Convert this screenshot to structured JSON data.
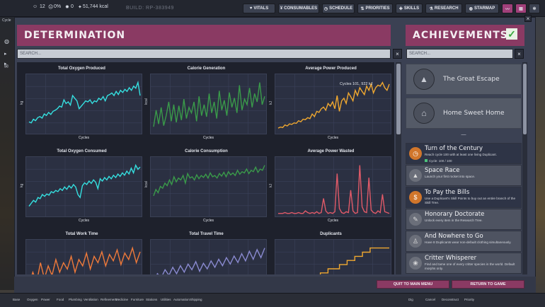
{
  "hud": {
    "dupes": "12",
    "stress": "0%",
    "germs": "0",
    "calories": "51,744 kcal",
    "build": "BUILD: RP-383949",
    "buttons": [
      "VITALS",
      "CONSUMABLES",
      "SCHEDULE",
      "PRIORITIES",
      "SKILLS",
      "RESEARCH",
      "STARMAP"
    ],
    "left_labels": [
      "Cycle"
    ]
  },
  "window": {
    "title": "DETERMINATION",
    "search_placeholder": "SEARCH...",
    "clear_label": "×",
    "close_label": "×"
  },
  "achievements_panel": {
    "title": "ACHIEVEMENTS",
    "search_placeholder": "SEARCH...",
    "clear_label": "×",
    "check_icon": "check-icon",
    "featured": [
      {
        "name": "The Great Escape",
        "icon": "rocket-icon"
      },
      {
        "name": "Home Sweet Home",
        "icon": "house-icon"
      }
    ],
    "separator": "—",
    "items": [
      {
        "title": "Turn of the Century",
        "desc": "Reach cycle 100 with at least one living Duplicant.",
        "progress": "Cycle: 100 / 100",
        "state": "complete",
        "icon": "clock-icon",
        "color": "#d1762b"
      },
      {
        "title": "Space Race",
        "desc": "Launch your first rocket into space.",
        "progress": "",
        "state": "locked",
        "icon": "rocket-icon",
        "color": "#6b6f7a"
      },
      {
        "title": "To Pay the Bills",
        "desc": "Use a Duplicant's Skill Points to buy out an entire branch of the Skill Tree.",
        "progress": "",
        "state": "complete",
        "icon": "coin-icon",
        "color": "#d1762b"
      },
      {
        "title": "Honorary Doctorate",
        "desc": "Unlock every item in the Research Tree.",
        "progress": "",
        "state": "locked",
        "icon": "cap-icon",
        "color": "#6b6f7a"
      },
      {
        "title": "And Nowhere to Go",
        "desc": "Have 8 Duplicants wear non-default clothing simultaneously.",
        "progress": "",
        "state": "locked",
        "icon": "person-icon",
        "color": "#6b6f7a"
      },
      {
        "title": "Critter Whisperer",
        "desc": "Find and tame one of every critter species in the world. Default morphs only.",
        "progress": "",
        "state": "locked",
        "icon": "critter-icon",
        "color": "#6b6f7a"
      }
    ]
  },
  "footer": {
    "quit_label": "QUIT TO MAIN MENU",
    "return_label": "RETURN TO GAME"
  },
  "bottom_bar": [
    "Base",
    "Oxygen",
    "Power",
    "Food",
    "Plumbing",
    "Ventilation",
    "Refinement",
    "Medicine",
    "Furniture",
    "Stations",
    "Utilities",
    "Automation",
    "Shipping",
    "Dig",
    "Cancel",
    "Deconstruct",
    "Priority"
  ],
  "charts": [
    {
      "title": "Total Oxygen Produced",
      "xlabel": "Cycles",
      "ylabel": "kg",
      "color": "#35e0e0",
      "annotation": "",
      "chart_data": {
        "type": "line",
        "values": [
          20,
          18,
          25,
          22,
          28,
          30,
          27,
          35,
          32,
          38,
          34,
          40,
          42,
          45,
          50,
          48,
          62,
          55,
          58,
          52,
          70,
          65,
          60,
          45,
          50,
          55,
          60,
          58,
          62,
          55,
          60,
          58,
          65,
          62,
          68,
          60,
          70,
          72,
          75,
          70,
          78,
          72,
          80,
          76,
          82,
          78,
          85,
          80,
          88,
          84,
          95,
          70
        ]
      }
    },
    {
      "title": "Calorie Generation",
      "xlabel": "Cycles",
      "ylabel": "kcal",
      "color": "#3a9a4a",
      "annotation": "",
      "chart_data": {
        "type": "line",
        "values": [
          10,
          40,
          15,
          45,
          12,
          30,
          55,
          20,
          50,
          18,
          48,
          22,
          60,
          25,
          45,
          35,
          55,
          20,
          65,
          30,
          50,
          28,
          70,
          35,
          55,
          25,
          75,
          40,
          58,
          30,
          72,
          45,
          62,
          35,
          85,
          40,
          60,
          50,
          80,
          45,
          70,
          55,
          90,
          50,
          65
        ]
      }
    },
    {
      "title": "Average Power Produced",
      "xlabel": "Cycles",
      "ylabel": "kJ",
      "color": "#f0a830",
      "annotation": "Cycles 101, 922 kJ",
      "chart_data": {
        "type": "line",
        "values": [
          8,
          10,
          9,
          14,
          12,
          16,
          15,
          18,
          17,
          22,
          20,
          25,
          24,
          28,
          26,
          35,
          30,
          40,
          38,
          45,
          48,
          42,
          55,
          50,
          58,
          45,
          70,
          40,
          60,
          65,
          55,
          75,
          68,
          60,
          80,
          70,
          85,
          78,
          72,
          88,
          80,
          92,
          75,
          85,
          90,
          88,
          95,
          85,
          80,
          92
        ]
      }
    },
    {
      "title": "Total Oxygen Consumed",
      "xlabel": "Cycles",
      "ylabel": "kg",
      "color": "#35e0e0",
      "annotation": "",
      "chart_data": {
        "type": "line",
        "values": [
          15,
          20,
          25,
          22,
          30,
          28,
          35,
          32,
          36,
          34,
          40,
          38,
          42,
          40,
          45,
          42,
          48,
          44,
          50,
          46,
          52,
          48,
          35,
          30,
          50,
          55,
          52,
          58,
          54,
          60,
          56,
          45,
          62,
          58,
          64,
          60,
          66,
          62,
          68,
          64,
          70,
          66,
          72,
          68,
          75,
          70,
          80,
          72,
          85,
          78,
          82
        ]
      }
    },
    {
      "title": "Calorie Consumption",
      "xlabel": "Cycles",
      "ylabel": "kcal",
      "color": "#3a9a4a",
      "annotation": "",
      "chart_data": {
        "type": "line",
        "values": [
          30,
          40,
          35,
          45,
          42,
          50,
          46,
          55,
          48,
          60,
          52,
          58,
          55,
          62,
          50,
          65,
          58,
          60,
          55,
          63,
          57,
          62,
          59,
          64,
          58,
          66,
          60,
          62,
          58,
          65,
          61,
          67,
          60,
          68,
          63,
          66,
          62,
          70,
          64,
          68,
          66,
          72,
          65,
          70,
          68,
          75,
          67,
          72,
          70,
          78
        ]
      }
    },
    {
      "title": "Average Power Wasted",
      "xlabel": "Cycles",
      "ylabel": "kJ",
      "color": "#e05a68",
      "annotation": "",
      "chart_data": {
        "type": "line",
        "values": [
          2,
          2,
          2,
          3,
          2,
          2,
          3,
          2,
          2,
          3,
          2,
          2,
          5,
          3,
          2,
          3,
          2,
          4,
          2,
          3,
          20,
          5,
          2,
          3,
          2,
          4,
          50,
          8,
          3,
          2,
          4,
          3,
          30,
          5,
          2,
          3,
          60,
          10,
          4,
          3,
          45,
          6,
          3,
          2,
          5,
          3,
          25,
          4,
          3,
          2
        ]
      }
    },
    {
      "title": "Total Work Time",
      "xlabel": "",
      "ylabel": "",
      "color": "#f07a3a",
      "annotation": "",
      "chart_data": {
        "type": "line",
        "values": [
          20,
          40,
          25,
          55,
          30,
          50,
          35,
          60,
          40,
          55,
          45,
          65,
          40,
          60,
          50,
          70,
          45,
          65,
          55,
          72,
          50,
          68,
          58,
          75,
          52,
          70,
          60,
          78,
          55,
          72
        ]
      }
    },
    {
      "title": "Total Travel Time",
      "xlabel": "",
      "ylabel": "",
      "color": "#8a8ad0",
      "annotation": "",
      "chart_data": {
        "type": "line",
        "values": [
          20,
          30,
          25,
          35,
          28,
          38,
          30,
          40,
          32,
          42,
          35,
          45,
          33,
          43,
          36,
          46,
          38,
          48,
          40,
          50,
          42,
          52,
          44,
          55,
          46,
          58,
          48,
          60,
          50,
          62
        ]
      }
    },
    {
      "title": "Duplicants",
      "xlabel": "",
      "ylabel": "",
      "color": "#f0a830",
      "annotation": "",
      "chart_data": {
        "type": "line",
        "step": true,
        "values": [
          1,
          1,
          2,
          2,
          3,
          3,
          4,
          4,
          4,
          5,
          5,
          6,
          6,
          7,
          7,
          7,
          8,
          8,
          9,
          9,
          10,
          10,
          11,
          11,
          12,
          12,
          12,
          12,
          12,
          12
        ]
      }
    }
  ]
}
